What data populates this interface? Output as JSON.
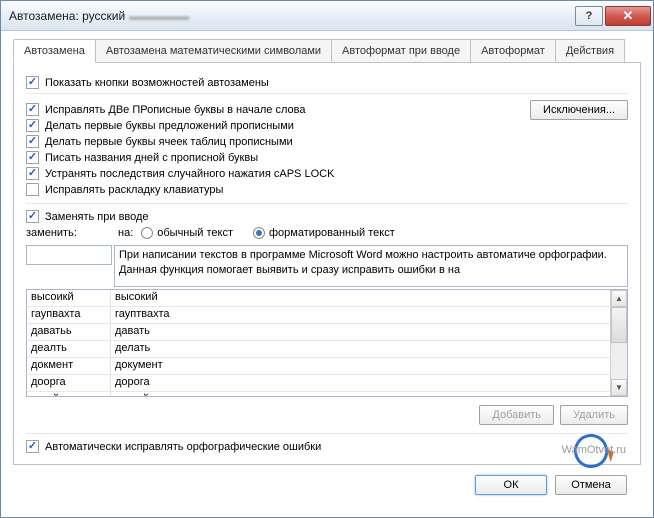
{
  "title": "Автозамена: русский",
  "tabs": [
    "Автозамена",
    "Автозамена математическими символами",
    "Автоформат при вводе",
    "Автоформат",
    "Действия"
  ],
  "activeTab": 0,
  "top_checkbox": {
    "label": "Показать кнопки возможностей автозамены",
    "checked": true
  },
  "options": [
    {
      "label": "Исправлять ДВе ПРописные буквы в начале слова",
      "checked": true
    },
    {
      "label": "Делать первые буквы предложений прописными",
      "checked": true
    },
    {
      "label": "Делать первые буквы ячеек таблиц прописными",
      "checked": true
    },
    {
      "label": "Писать названия дней с прописной буквы",
      "checked": true
    },
    {
      "label": "Устранять последствия случайного нажатия cAPS LOCK",
      "checked": true
    },
    {
      "label": "Исправлять раскладку клавиатуры",
      "checked": false
    }
  ],
  "exceptions_btn": "Исключения...",
  "replace_on_type": {
    "label": "Заменять при вводе",
    "checked": true
  },
  "replace_label": "заменить:",
  "with_label": "на:",
  "radio_plain": "обычный текст",
  "radio_formatted": "форматированный текст",
  "radio_selected": "formatted",
  "replace_input": "",
  "with_preview": "При написании текстов в программе Microsoft Word можно настроить автоматиче орфографии. Данная функция помогает выявить и сразу исправить ошибки в на",
  "list": [
    {
      "from": "высоикй",
      "to": "высокий"
    },
    {
      "from": "гаупвахта",
      "to": "гауптвахта"
    },
    {
      "from": "даватьь",
      "to": "давать"
    },
    {
      "from": "деалть",
      "to": "делать"
    },
    {
      "from": "докмент",
      "to": "документ"
    },
    {
      "from": "доорга",
      "to": "дорога"
    },
    {
      "from": "другйо",
      "to": "другой"
    }
  ],
  "add_btn": "Добавить",
  "delete_btn": "Удалить",
  "auto_correct_spelling": {
    "label": "Автоматически исправлять орфографические ошибки",
    "checked": true
  },
  "ok_btn": "ОК",
  "cancel_btn": "Отмена",
  "watermark": "WamOtvet.ru"
}
